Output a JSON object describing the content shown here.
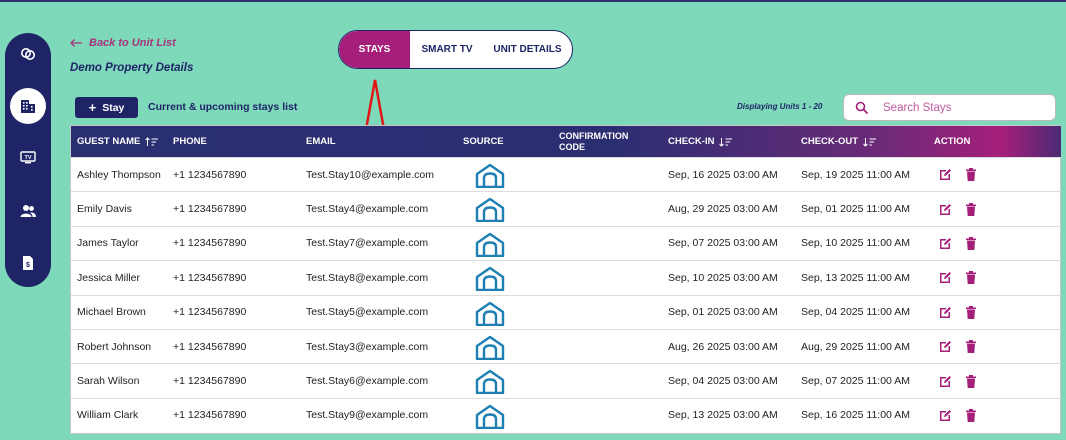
{
  "header": {
    "back_label": "Back to Unit List",
    "property_title": "Demo Property Details"
  },
  "tabs": [
    {
      "label": "STAYS",
      "active": true
    },
    {
      "label": "SMART TV",
      "active": false
    },
    {
      "label": "UNIT DETAILS",
      "active": false
    }
  ],
  "toolbar": {
    "add_label": "Stay",
    "list_caption": "Current & upcoming stays list",
    "displaying": "Displaying Units 1 - 20"
  },
  "search": {
    "placeholder": "Search Stays",
    "value": ""
  },
  "table": {
    "columns": {
      "guest_name": "GUEST NAME",
      "phone": "PHONE",
      "email": "EMAIL",
      "source": "SOURCE",
      "confirmation_line1": "CONFIRMATION",
      "confirmation_line2": "CODE",
      "check_in": "CHECK-IN",
      "check_out": "CHECK-OUT",
      "action": "ACTION"
    },
    "rows": [
      {
        "name": "Ashley Thompson",
        "phone": "+1 1234567890",
        "email": "Test.Stay10@example.com",
        "code": "",
        "check_in": "Sep, 16 2025 03:00 AM",
        "check_out": "Sep, 19 2025 11:00 AM"
      },
      {
        "name": "Emily Davis",
        "phone": "+1 1234567890",
        "email": "Test.Stay4@example.com",
        "code": "",
        "check_in": "Aug, 29 2025 03:00 AM",
        "check_out": "Sep, 01 2025 11:00 AM"
      },
      {
        "name": "James Taylor",
        "phone": "+1 1234567890",
        "email": "Test.Stay7@example.com",
        "code": "",
        "check_in": "Sep, 07 2025 03:00 AM",
        "check_out": "Sep, 10 2025 11:00 AM"
      },
      {
        "name": "Jessica Miller",
        "phone": "+1 1234567890",
        "email": "Test.Stay8@example.com",
        "code": "",
        "check_in": "Sep, 10 2025 03:00 AM",
        "check_out": "Sep, 13 2025 11:00 AM"
      },
      {
        "name": "Michael Brown",
        "phone": "+1 1234567890",
        "email": "Test.Stay5@example.com",
        "code": "",
        "check_in": "Sep, 01 2025 03:00 AM",
        "check_out": "Sep, 04 2025 11:00 AM"
      },
      {
        "name": "Robert Johnson",
        "phone": "+1 1234567890",
        "email": "Test.Stay3@example.com",
        "code": "",
        "check_in": "Aug, 26 2025 03:00 AM",
        "check_out": "Aug, 29 2025 11:00 AM"
      },
      {
        "name": "Sarah Wilson",
        "phone": "+1 1234567890",
        "email": "Test.Stay6@example.com",
        "code": "",
        "check_in": "Sep, 04 2025 03:00 AM",
        "check_out": "Sep, 07 2025 11:00 AM"
      },
      {
        "name": "William Clark",
        "phone": "+1 1234567890",
        "email": "Test.Stay9@example.com",
        "code": "",
        "check_in": "Sep, 13 2025 03:00 AM",
        "check_out": "Sep, 16 2025 11:00 AM"
      }
    ]
  },
  "sidebar": {
    "items": [
      {
        "icon": "link-icon",
        "active": false
      },
      {
        "icon": "buildings-icon",
        "active": true
      },
      {
        "icon": "tv-icon",
        "active": false
      },
      {
        "icon": "users-icon",
        "active": false
      },
      {
        "icon": "billing-document-icon",
        "active": false
      }
    ]
  },
  "icons": {
    "source": "home-outline-icon",
    "edit": "edit-icon",
    "delete": "trash-icon",
    "sort": "sort-icon",
    "search": "search-icon",
    "back": "arrow-left-icon",
    "add": "plus-icon"
  },
  "colors": {
    "background": "#7dd9b9",
    "navy": "#1f2467",
    "magenta": "#a51f7a",
    "source_icon": "#1e7fb4",
    "annotation_arrow": "#e01818"
  }
}
